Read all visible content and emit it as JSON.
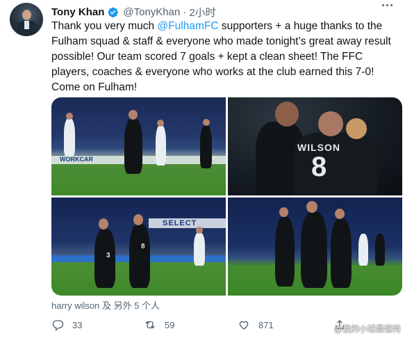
{
  "tweet": {
    "display_name": "Tony Khan",
    "handle": "@TonyKhan",
    "separator": "·",
    "time": "2小时",
    "text_before_mention": "Thank you very much ",
    "mention": "@FulhamFC",
    "text_after_mention": " supporters + a huge thanks to the Fulham squad & staff & everyone who made tonight’s great away result possible! Our team scored 7 goals + kept a clean sheet! The FFC players, coaches & everyone who works at the club earned this 7-0! Come on Fulham!"
  },
  "media": {
    "photo_2_shirt_name": "WILSON",
    "photo_2_shirt_number": "8",
    "photo_3_board_text": "SELECT",
    "photo_3_shirt_number": "8",
    "photo_3_shirt_number_2": "3",
    "photo_1_board_text": "WORKCAR"
  },
  "tagged": {
    "text": "harry wilson 及 另外 5 个人"
  },
  "actions": {
    "reply_count": "33",
    "retweet_count": "59",
    "like_count": "871"
  },
  "watermark": "@我的小球最强特",
  "colors": {
    "accent": "#1d9bf0",
    "secondary_text": "#536471",
    "primary_text": "#0f1419"
  },
  "icons": [
    "verified-badge-icon",
    "more-icon",
    "reply-icon",
    "retweet-icon",
    "like-icon",
    "share-icon"
  ]
}
